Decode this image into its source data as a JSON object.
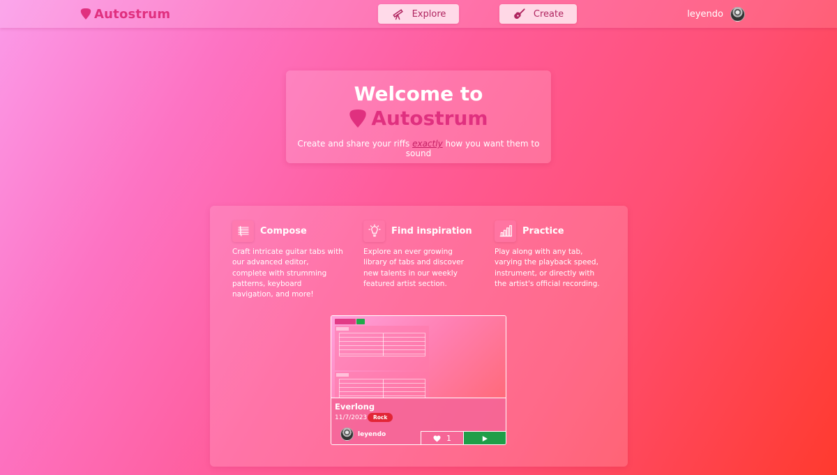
{
  "nav": {
    "brand": "Autostrum",
    "explore_label": "Explore",
    "create_label": "Create",
    "username": "leyendo"
  },
  "hero": {
    "title": "Welcome to",
    "brand": "Autostrum",
    "subtitle_pre": "Create and share your riffs ",
    "subtitle_em": "exactly",
    "subtitle_post": " how you want them to sound"
  },
  "features": [
    {
      "title": "Compose",
      "icon": "sheet-music-icon",
      "description": "Craft intricate guitar tabs with our advanced editor, complete with strumming patterns, keyboard navigation, and more!"
    },
    {
      "title": "Find inspiration",
      "icon": "lightbulb-icon",
      "description": "Explore an ever growing library of tabs and discover new talents in our weekly featured artist section."
    },
    {
      "title": "Practice",
      "icon": "bar-chart-icon",
      "description": "Play along with any tab, varying the playback speed, instrument, or directly with the artist's official recording."
    }
  ],
  "card": {
    "title": "Everlong",
    "date": "11/7/2023",
    "genre": "Rock",
    "author": "leyendo",
    "likes": "1"
  },
  "colors": {
    "brand": "#e0307f",
    "genre_badge": "#e22536",
    "play_button": "#1f9e48"
  }
}
